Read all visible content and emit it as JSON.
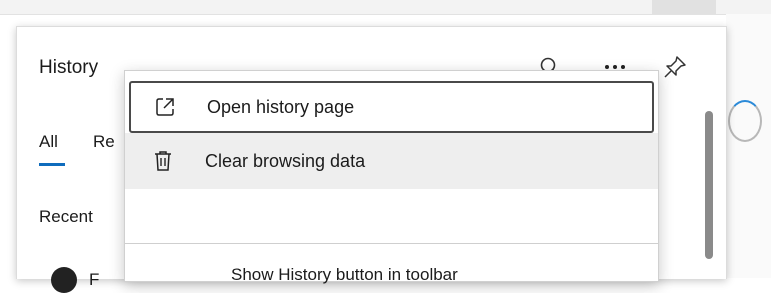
{
  "panel": {
    "title": "History",
    "header_icons": [
      "search-icon",
      "more-icon",
      "pin-icon"
    ],
    "tabs": [
      {
        "label": "All",
        "selected": true
      },
      {
        "label": "Re",
        "selected": false
      }
    ],
    "section_label": "Recent",
    "partial_row_text": "F"
  },
  "context_menu": {
    "items": [
      {
        "label": "Open history page",
        "icon": "open-external-icon",
        "state": "focused"
      },
      {
        "label": "Clear browsing data",
        "icon": "trash-icon",
        "state": "hovered"
      }
    ],
    "partial_item_text": "Show History button in toolbar"
  },
  "colors": {
    "accent": "#0f6cbd",
    "hover_bg": "#eeeeee",
    "focus_ring": "#4a4a4a"
  }
}
